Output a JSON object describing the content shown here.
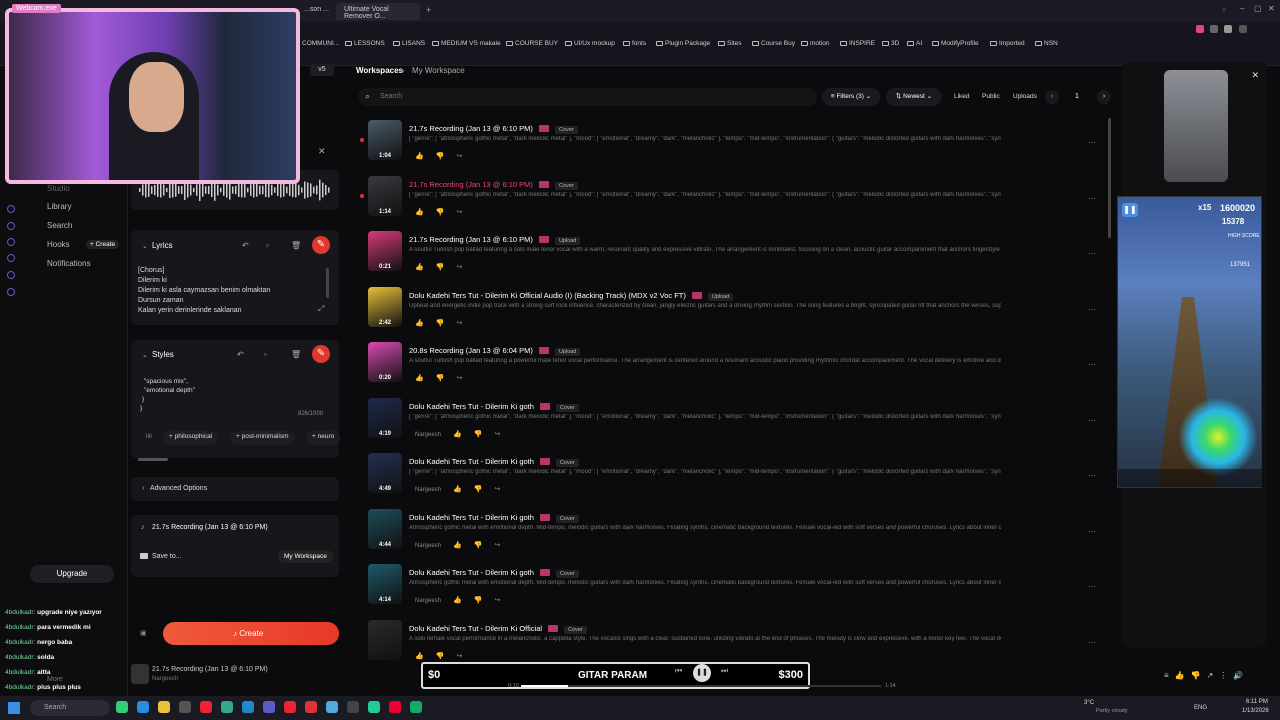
{
  "browser": {
    "tabs": [
      "Webcam.exe",
      "...son ...",
      "Ultimate Vocal Remover O..."
    ],
    "bookmarks": [
      "COMMUNI...",
      "LESSONS",
      "LISANS",
      "MEDIUM VS makale",
      "COURSE BUY",
      "UI/Ux mockup",
      "fonts",
      "Plugin Package",
      "Sites",
      "Course Buy",
      "motion",
      "INSPIRE",
      "3D",
      "AI",
      "ModifyProfile",
      "Imported",
      "NSN"
    ]
  },
  "webcam": {
    "label": "Webcam.exe"
  },
  "sidebar": {
    "items": [
      "Studio",
      "Library",
      "Search",
      "Hooks",
      "Notifications"
    ],
    "create_chip": "+ Create",
    "upgrade": "Upgrade",
    "more": "More"
  },
  "create": {
    "version": "v5",
    "lyrics_title": "Lyrics",
    "lyrics_lines": [
      "[Chorus]",
      "Dilerim ki",
      "Dilerim ki asla caymazsan benim olmaktan",
      "Dursun zaman",
      "Kalan yerin derinlerinde saklanan"
    ],
    "styles_title": "Styles",
    "styles_lines": [
      "\"spacious mix\",",
      "\"emotional depth\"",
      "}",
      "}"
    ],
    "styles_count": "826/1000",
    "chips": [
      "+ philosophical",
      "+ post-minimalism",
      "+ neuro"
    ],
    "chip_prefix": "lili",
    "advanced": "Advanced Options",
    "selected_song": "21.7s Recording (Jan 13 @ 6:10 PM)",
    "save_to": "Save to...",
    "workspace": "My Workspace",
    "create_btn": "Create",
    "queue_title": "21.7s Recording (Jan 13 @ 6:10 PM)",
    "queue_sub": "Nargeesh"
  },
  "header": {
    "breadcrumb_root": "Workspaces",
    "breadcrumb_current": "My Workspace",
    "search_placeholder": "Search",
    "filters": "Filters (3)",
    "sort": "Newest",
    "liked": "Liked",
    "public": "Public",
    "uploads": "Uploads",
    "page": "1"
  },
  "songs": [
    {
      "title": "21.7s Recording (Jan 13 @ 6:10 PM)",
      "badge": "Cover",
      "desc": "[ \"genre\": [ \"atmospheric gothic metal\", \"dark melodic metal\" ], \"mood\": [ \"emotional\", \"dreamy\", \"dark\", \"melancholic\" ], \"tempo\": \"mid-tempo\", \"instrumentation\": { \"guitars\": \"melodic distorted guitars with dark harmonies\", \"synths\": \"floating amb...",
      "dur": "1:04",
      "color": "#4a5a6a",
      "highlight": false,
      "author": ""
    },
    {
      "title": "21.7s Recording (Jan 13 @ 6:10 PM)",
      "badge": "Cover",
      "desc": "[ \"genre\": [ \"atmospheric gothic metal\", \"dark melodic metal\" ], \"mood\": [ \"emotional\", \"dreamy\", \"dark\", \"melancholic\" ], \"tempo\": \"mid-tempo\", \"instrumentation\": { \"guitars\": \"melodic distorted guitars with dark harmonies\", \"synths\": \"floating amb...",
      "dur": "1:14",
      "color": "#3a3a40",
      "highlight": true,
      "author": ""
    },
    {
      "title": "21.7s Recording (Jan 13 @ 6:10 PM)",
      "badge": "Upload",
      "desc": "A soulful Turkish pop ballad featuring a solo male tenor vocal with a warm, resonant quality and expressive vibrato. The arrangement is minimalist, focusing on a clean, acoustic guitar accompaniment that anchors fingerstyle techniques an...",
      "dur": "0:21",
      "color": "#d63a7a",
      "highlight": false,
      "author": ""
    },
    {
      "title": "Dolu Kadehi Ters Tut - Dilerim Ki Official Audio (I) (Backing Track) (MDX v2 Voc FT)",
      "badge": "Upload",
      "desc": "Upbeat and energetic indie pop track with a strong surf rock influence, characterized by clean, jangly electric guitars and a driving rhythm section. The song features a bright, syncopated guitar riff that anchors the verses, supported by...",
      "dur": "2:42",
      "color": "#e6c03a",
      "highlight": false,
      "author": ""
    },
    {
      "title": "20.8s Recording (Jan 13 @ 6:04 PM)",
      "badge": "Upload",
      "desc": "A soulful Turkish pop ballad featuring a powerful male tenor vocal performance. The arrangement is centered around a resonant acoustic piano providing rhythmic chordal accompaniment. The vocal delivery is emotive and dynamic, utili...",
      "dur": "0:20",
      "color": "#d84ab2",
      "highlight": false,
      "author": ""
    },
    {
      "title": "Dolu Kadehi Ters Tut - Dilerim Ki goth",
      "badge": "Cover",
      "desc": "[ \"genre\": [ \"atmospheric gothic metal\", \"dark melodic metal\" ], \"mood\": [ \"emotional\", \"dreamy\", \"dark\", \"melancholic\" ], \"tempo\": \"mid-tempo\", \"instrumentation\": { \"guitars\": \"melodic distorted guitars with dark harmonies\", \"synths\": \"floating amb...",
      "dur": "4:19",
      "color": "#1f2a4a",
      "highlight": false,
      "author": "Nargeesh"
    },
    {
      "title": "Dolu Kadehi Ters Tut - Dilerim Ki goth",
      "badge": "Cover",
      "desc": "[ \"genre\": [ \"atmospheric gothic metal\", \"dark melodic metal\" ], \"mood\": [ \"emotional\", \"dreamy\", \"dark\", \"melancholic\" ], \"tempo\": \"mid-tempo\", \"instrumentation\": { \"guitars\": \"melodic distorted guitars with dark harmonies\", \"synths\": \"floating amb...",
      "dur": "4:49",
      "color": "#243050",
      "highlight": false,
      "author": "Nargeesh"
    },
    {
      "title": "Dolu Kadehi Ters Tut - Dilerim Ki goth",
      "badge": "Cover",
      "desc": "Atmospheric gothic metal with emotional depth. Mid-tempo, melodic guitars with dark harmonies. Floating synths, cinematic background textures. Female vocal-led with soft verses and powerful choruses. Lyrics about inner conflict, fad...",
      "dur": "4:44",
      "color": "#1e4e5a",
      "highlight": false,
      "author": "Nargeesh"
    },
    {
      "title": "Dolu Kadehi Ters Tut - Dilerim Ki goth",
      "badge": "Cover",
      "desc": "Atmospheric gothic metal with emotional depth. Mid-tempo, melodic guitars with dark harmonies. Floating synths, cinematic background textures. Female vocal-led with soft verses and powerful choruses. Lyrics about inner conflict, fad...",
      "dur": "4:14",
      "color": "#1e5a6a",
      "highlight": false,
      "author": "Nargeesh"
    },
    {
      "title": "Dolu Kadehi Ters Tut - Dilerim Ki Official",
      "badge": "Cover",
      "desc": "A solo female vocal performance in a melancholic, a cappella style. The vocalist sings with a clear, sustained tone, utilizing vibrato at the end of phrases. The melody is slow and expressive, with a minor key feel. The vocal delivery is inten...",
      "dur": "",
      "color": "#2a2a2e",
      "highlight": false,
      "author": ""
    }
  ],
  "player": {
    "left": "$0",
    "title": "GITAR PARAM",
    "right": "$300",
    "time_cur": "0:10",
    "time_total": "1:14",
    "progress": 0.13
  },
  "game": {
    "multiplier": "x15",
    "score": "1600020",
    "coins": "15378",
    "hiscore_label": "HIGH SCORE",
    "hiscore": "137951"
  },
  "chat": [
    {
      "user": "4bdulkadr:",
      "msg": "upgrade niye yazıyor"
    },
    {
      "user": "4bdulkadr:",
      "msg": "para vermedik mi"
    },
    {
      "user": "4bdulkadr:",
      "msg": "nergo baba"
    },
    {
      "user": "4bdulkadr:",
      "msg": "solda"
    },
    {
      "user": "4bdulkadr:",
      "msg": "altta"
    },
    {
      "user": "4bdulkadr:",
      "msg": "plus plus plus"
    }
  ],
  "taskbar": {
    "weather_temp": "3°C",
    "weather_desc": "Partly cloudy",
    "lang": "ENG",
    "time": "6:11 PM",
    "date": "1/13/2026",
    "search": "Search"
  },
  "colors": {
    "accent": "#e0382d",
    "highlight_title": "#e8477a",
    "bg": "#0b0b0d"
  }
}
